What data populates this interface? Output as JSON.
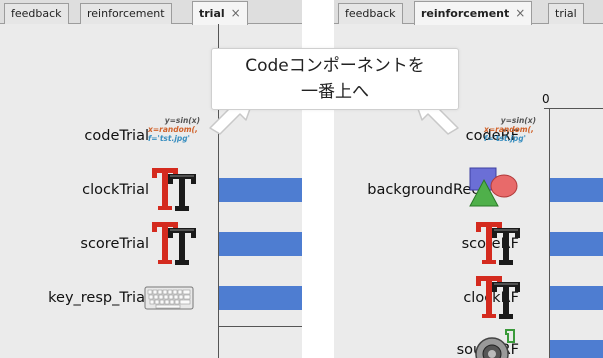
{
  "left_panel": {
    "tabs": [
      {
        "label": "feedback",
        "active": false
      },
      {
        "label": "reinforcement",
        "active": false
      },
      {
        "label": "trial",
        "active": true,
        "close": "×"
      }
    ],
    "components": [
      {
        "label": "codeTrial",
        "icon": "code-icon",
        "code_lines": [
          "y=sin(x)",
          "x=random(,",
          "f='tst.jpg'"
        ]
      },
      {
        "label": "clockTrial",
        "icon": "text-tt-icon"
      },
      {
        "label": "scoreTrial",
        "icon": "text-tt-icon"
      },
      {
        "label": "key_resp_Trial",
        "icon": "keyboard-icon"
      }
    ]
  },
  "right_panel": {
    "tabs": [
      {
        "label": "feedback",
        "active": false
      },
      {
        "label": "reinforcement",
        "active": true,
        "close": "×"
      },
      {
        "label": "trial",
        "active": false
      }
    ],
    "timeline_zero": "0",
    "components": [
      {
        "label": "codeRF",
        "icon": "code-icon",
        "code_lines": [
          "y=sin(x)",
          "x=random(,",
          "f='tst.jpg'"
        ]
      },
      {
        "label": "backgroundRect",
        "icon": "shapes-icon"
      },
      {
        "label": "scoreRF",
        "icon": "text-tt-icon"
      },
      {
        "label": "clockRF",
        "icon": "text-tt-icon"
      },
      {
        "label": "soundRF",
        "icon": "speaker-icon"
      }
    ]
  },
  "callout": {
    "line1": "Codeコンポーネントを",
    "line2": "一番上へ"
  },
  "colors": {
    "bar": "#4e7dd1",
    "panel_bg": "#ebebeb",
    "tt_red": "#d42a1e",
    "tt_black": "#1a1a1a"
  }
}
